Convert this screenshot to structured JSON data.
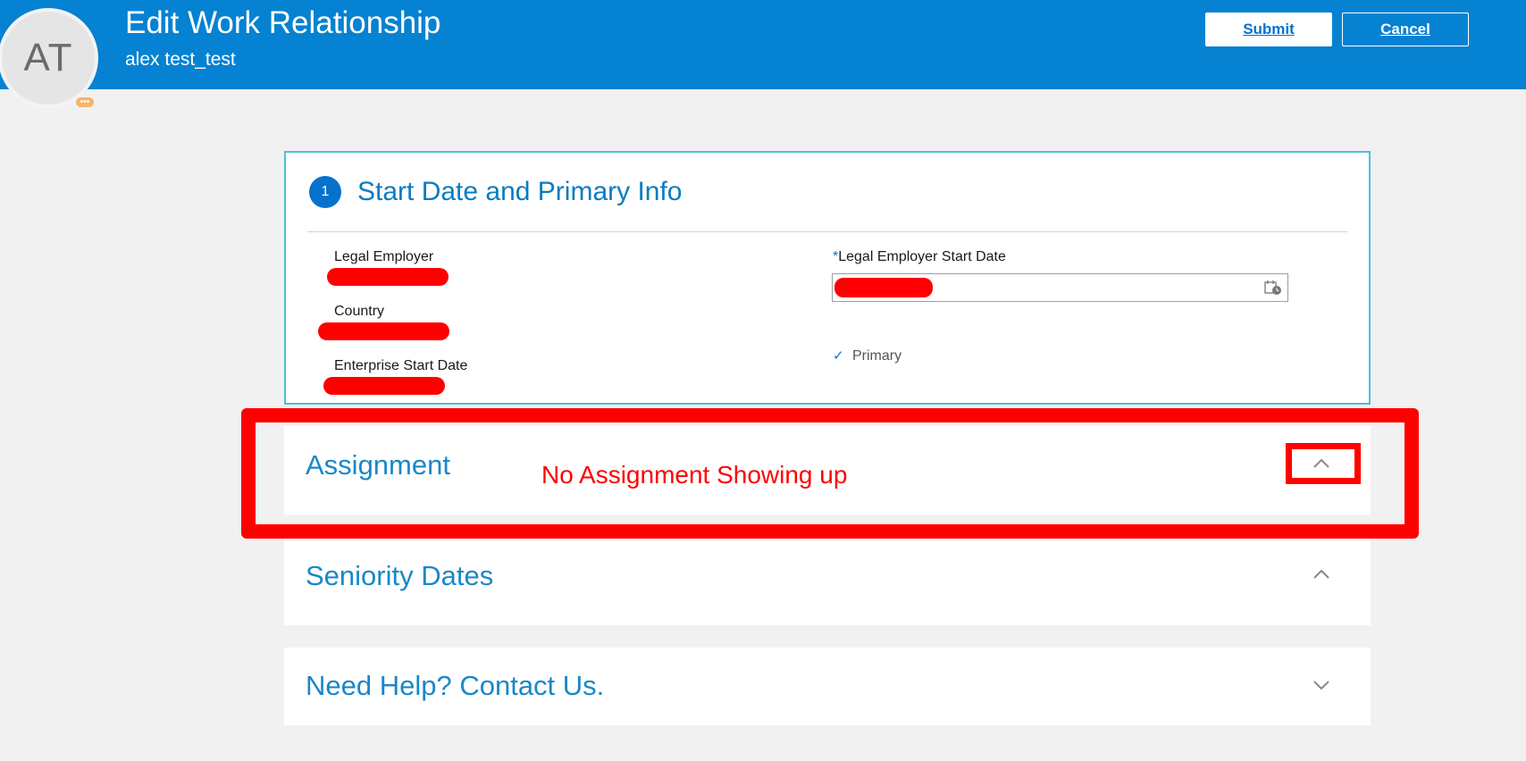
{
  "header": {
    "avatar_initials": "AT",
    "avatar_badge": "•••",
    "title": "Edit Work Relationship",
    "subtitle": "alex test_test",
    "submit_label": {
      "pre": "Sub",
      "mnemonic": "m",
      "post": "it"
    },
    "cancel_label": {
      "mnemonic": "C",
      "post": "ancel"
    }
  },
  "step1": {
    "number": "1",
    "title": "Start Date and Primary Info",
    "fields": {
      "legal_employer_label": "Legal Employer",
      "country_label": "Country",
      "enterprise_start_date_label": "Enterprise Start Date",
      "legal_employer_start_date_required": "*",
      "legal_employer_start_date_label": "Legal Employer Start Date",
      "primary_check": "✓",
      "primary_label": "Primary"
    }
  },
  "sections": {
    "assignment": {
      "title": "Assignment",
      "expanded": true
    },
    "seniority": {
      "title": "Seniority Dates",
      "expanded": true
    },
    "help": {
      "title": "Need Help? Contact Us.",
      "expanded": false
    }
  },
  "annotation": {
    "text": "No Assignment Showing up",
    "color": "#ff0000"
  },
  "colors": {
    "header_bg": "#0582d2",
    "accent": "#0572ce",
    "section_title": "#1a87c9",
    "step_border": "#4ac0d5",
    "redaction": "#ff0000"
  }
}
